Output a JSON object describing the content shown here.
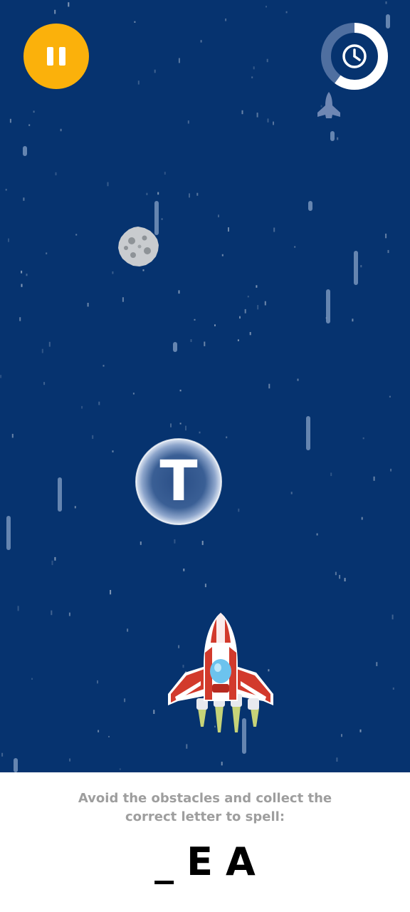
{
  "colors": {
    "space": "#06336f",
    "pause_button": "#fbb10b",
    "timer_ring_track": "#4f6fa0",
    "timer_ring_progress": "#ffffff",
    "instruction_text": "#9e9e9e"
  },
  "hud": {
    "pause_icon": "pause-icon",
    "timer_icon": "clock-icon",
    "timer_remaining_fraction": 0.6
  },
  "bubble": {
    "letter": "T"
  },
  "instruction": {
    "text": "Avoid the obstacles and collect the correct letter to spell:"
  },
  "word": {
    "letters": [
      "_",
      "E",
      "A"
    ]
  }
}
